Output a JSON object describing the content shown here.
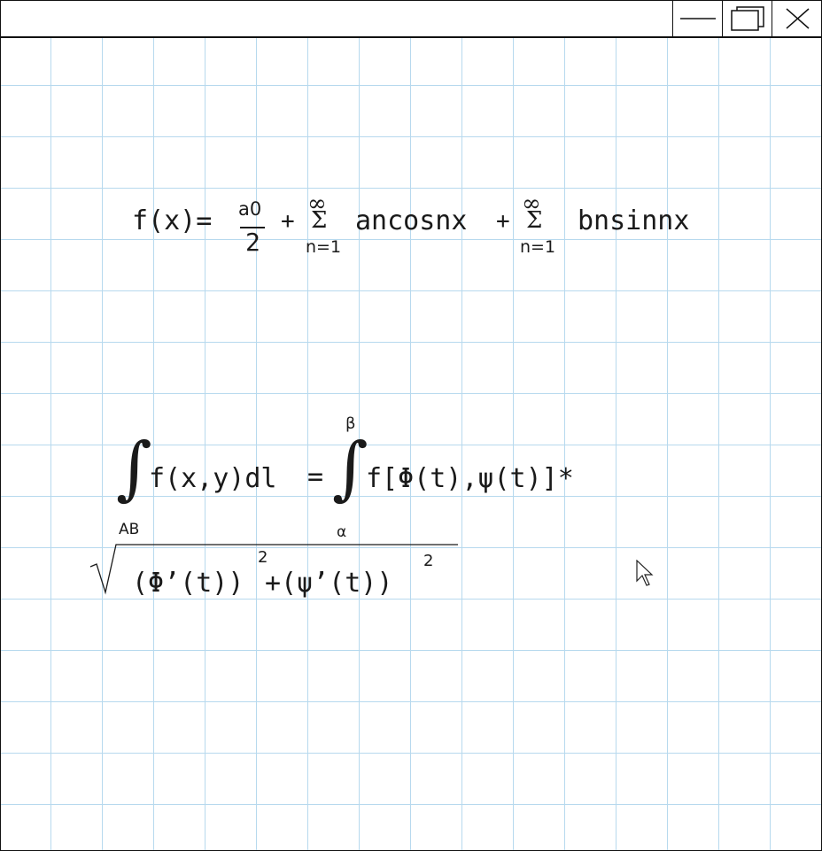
{
  "window": {
    "minimize_icon": "minimize-icon",
    "maximize_icon": "restore-icon",
    "close_icon": "close-icon"
  },
  "formula1": {
    "lhs": "f(x)=",
    "frac_num": "a0",
    "frac_den": "2",
    "plus1": "+",
    "sum1_upper": "∞",
    "sum1_symbol": "Σ",
    "sum1_lower": "n=1",
    "term1": "ancosnx",
    "plus2": "+",
    "sum2_upper": "∞",
    "sum2_symbol": "Σ",
    "sum2_lower": "n=1",
    "term2": "bnsinnx"
  },
  "formula2": {
    "integral1_symbol": "∫",
    "integral1_lower": "AB",
    "integrand1": "f(x,y)dl",
    "equals": "=",
    "integral2_symbol": "∫",
    "integral2_upper": "β",
    "integral2_lower": "α",
    "integrand2": "f[Φ(t),ψ(t)]*",
    "sqrt_symbol": "√",
    "radicand_part1": "(Φ’(t))",
    "exp1": "2",
    "radicand_plus": "+",
    "radicand_part2": "(ψ’(t))",
    "exp2": "2"
  },
  "cursor_icon": "mouse-pointer-icon"
}
